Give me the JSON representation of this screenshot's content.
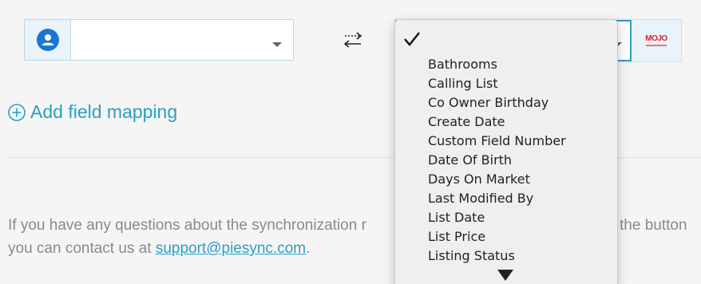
{
  "left_field": {
    "icon": "user-icon",
    "value": ""
  },
  "swap_icon": "swap-arrows-icon",
  "right_field": {
    "logo": {
      "name": "mojo-logo",
      "text": "MOJO"
    }
  },
  "add_mapping": {
    "icon": "plus-circle-icon",
    "label": "Add field mapping"
  },
  "help": {
    "line1_start": "If you have any questions about the synchronization r",
    "line1_end": "the button",
    "line2_prefix": "you can contact us at ",
    "email": "support@piesync.com",
    "line2_suffix": "."
  },
  "dropdown": {
    "selected_check": "checkmark-icon",
    "items": [
      "Bathrooms",
      "Calling List",
      "Co Owner Birthday",
      "Create Date",
      "Custom Field Number",
      "Date Of Birth",
      "Days On Market",
      "Last Modified By",
      "List Date",
      "List Price",
      "Listing Status"
    ],
    "scroll_icon": "scroll-down-arrow-icon"
  },
  "colors": {
    "accent": "#2a9fc4",
    "icon_blue": "#1976d2",
    "logo_red": "#d9232a",
    "background": "#f5f5f5"
  }
}
